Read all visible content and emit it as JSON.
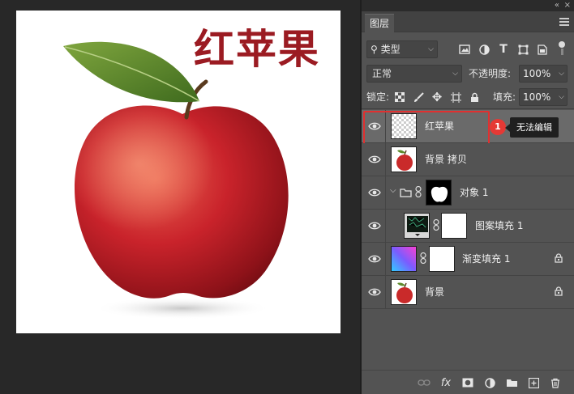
{
  "canvas": {
    "title": "红苹果"
  },
  "panel": {
    "tab_label": "图层",
    "collapse": "«",
    "close": "×",
    "filter": {
      "kind": "类型"
    },
    "blend_mode": "正常",
    "opacity_label": "不透明度:",
    "opacity_value": "100%",
    "lock_label": "锁定:",
    "fill_label": "填充:",
    "fill_value": "100%",
    "layers": [
      {
        "name": "红苹果",
        "selected": true
      },
      {
        "name": "背景 拷贝"
      },
      {
        "name": "对象 1"
      },
      {
        "name": "图案填充 1"
      },
      {
        "name": "渐变填充 1",
        "locked": true
      },
      {
        "name": "背景",
        "locked": true
      }
    ],
    "annotation": {
      "badge": "1",
      "tooltip": "无法编辑"
    },
    "bottom_icons": [
      "link-icon",
      "fx-icon",
      "mask-icon",
      "adjustment-icon",
      "group-icon",
      "new-layer-icon",
      "trash-icon"
    ],
    "fx_label": "fx"
  },
  "colors": {
    "title_red": "#9b1b22",
    "highlight_red": "#e03030",
    "panel_bg": "#535353"
  }
}
